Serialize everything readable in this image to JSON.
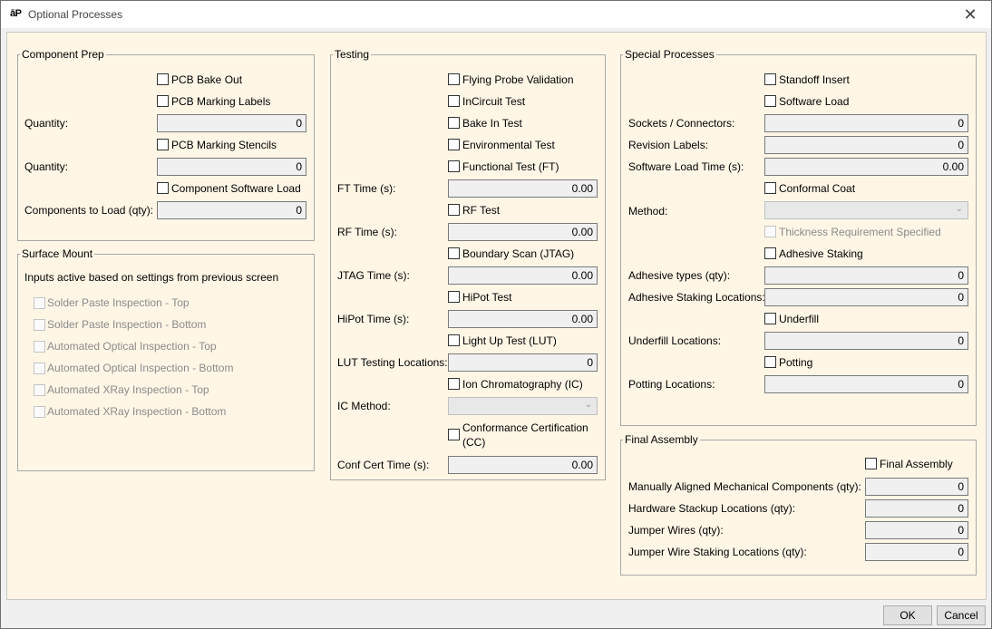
{
  "window": {
    "title": "Optional Processes",
    "app_icon": "āP"
  },
  "component_prep": {
    "title": "Component Prep",
    "pcb_bake_out": "PCB Bake Out",
    "pcb_marking_labels": "PCB Marking Labels",
    "quantity_label": "Quantity:",
    "labels_quantity": "0",
    "pcb_marking_stencils": "PCB Marking Stencils",
    "stencils_quantity": "0",
    "component_software_load": "Component Software Load",
    "components_to_load_label": "Components to Load (qty):",
    "components_to_load": "0"
  },
  "surface_mount": {
    "title": "Surface Mount",
    "note": "Inputs active based on settings from previous screen",
    "items": [
      "Solder Paste Inspection - Top",
      "Solder Paste Inspection - Bottom",
      "Automated Optical Inspection - Top",
      "Automated Optical Inspection - Bottom",
      "Automated XRay Inspection - Top",
      "Automated XRay Inspection - Bottom"
    ]
  },
  "testing": {
    "title": "Testing",
    "flying_probe": "Flying Probe Validation",
    "incircuit": "InCircuit Test",
    "bake_in": "Bake In Test",
    "environmental": "Environmental Test",
    "functional": "Functional Test (FT)",
    "ft_time_label": "FT Time (s):",
    "ft_time": "0.00",
    "rf_test": "RF Test",
    "rf_time_label": "RF Time (s):",
    "rf_time": "0.00",
    "boundary_scan": "Boundary Scan (JTAG)",
    "jtag_time_label": "JTAG Time (s):",
    "jtag_time": "0.00",
    "hipot": "HiPot Test",
    "hipot_time_label": "HiPot Time (s):",
    "hipot_time": "0.00",
    "light_up": "Light Up Test (LUT)",
    "lut_locations_label": "LUT Testing Locations:",
    "lut_locations": "0",
    "ion_chrom": "Ion Chromatography (IC)",
    "ic_method_label": "IC Method:",
    "conformance_line1": "Conformance Certification",
    "conformance_line2": "(CC)",
    "conf_cert_time_label": "Conf Cert Time (s):",
    "conf_cert_time": "0.00"
  },
  "special": {
    "title": "Special Processes",
    "standoff_insert": "Standoff Insert",
    "software_load": "Software Load",
    "sockets_label": "Sockets / Connectors:",
    "sockets": "0",
    "revision_labels_label": "Revision Labels:",
    "revision_labels": "0",
    "software_load_time_label": "Software Load Time (s):",
    "software_load_time": "0.00",
    "conformal_coat": "Conformal Coat",
    "method_label": "Method:",
    "thickness_req": "Thickness Requirement Specified",
    "adhesive_staking": "Adhesive Staking",
    "adhesive_types_label": "Adhesive types (qty):",
    "adhesive_types": "0",
    "adhesive_locations_label": "Adhesive Staking Locations:",
    "adhesive_locations": "0",
    "underfill": "Underfill",
    "underfill_locations_label": "Underfill Locations:",
    "underfill_locations": "0",
    "potting": "Potting",
    "potting_locations_label": "Potting Locations:",
    "potting_locations": "0"
  },
  "final_assembly": {
    "title": "Final Assembly",
    "checkbox": "Final Assembly",
    "manual_mech_label": "Manually Aligned Mechanical Components (qty):",
    "manual_mech": "0",
    "hardware_stackup_label": "Hardware Stackup Locations (qty):",
    "hardware_stackup": "0",
    "jumper_wires_label": "Jumper Wires (qty):",
    "jumper_wires": "0",
    "jumper_staking_label": "Jumper Wire Staking Locations (qty):",
    "jumper_staking": "0"
  },
  "buttons": {
    "ok": "OK",
    "cancel": "Cancel"
  }
}
